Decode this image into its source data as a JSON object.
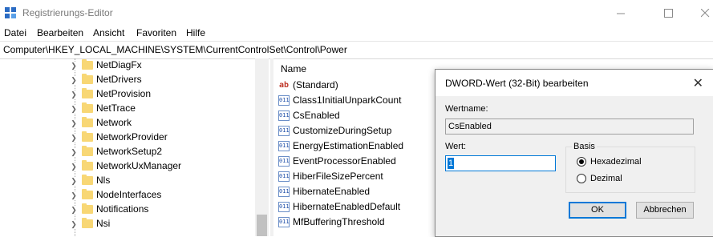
{
  "window": {
    "title": "Registrierungs-Editor",
    "minimize_icon": "minimize-icon",
    "maximize_icon": "maximize-icon",
    "close_icon": "close-icon"
  },
  "menu": [
    "Datei",
    "Bearbeiten",
    "Ansicht",
    "Favoriten",
    "Hilfe"
  ],
  "address": "Computer\\HKEY_LOCAL_MACHINE\\SYSTEM\\CurrentControlSet\\Control\\Power",
  "tree": {
    "items": [
      {
        "label": "NetDiagFx",
        "expandable": true
      },
      {
        "label": "NetDrivers",
        "expandable": true
      },
      {
        "label": "NetProvision",
        "expandable": true
      },
      {
        "label": "NetTrace",
        "expandable": true
      },
      {
        "label": "Network",
        "expandable": true
      },
      {
        "label": "NetworkProvider",
        "expandable": true
      },
      {
        "label": "NetworkSetup2",
        "expandable": true
      },
      {
        "label": "NetworkUxManager",
        "expandable": true
      },
      {
        "label": "Nls",
        "expandable": true
      },
      {
        "label": "NodeInterfaces",
        "expandable": true
      },
      {
        "label": "Notifications",
        "expandable": true
      },
      {
        "label": "Nsi",
        "expandable": true
      }
    ]
  },
  "list": {
    "header": "Name",
    "items": [
      {
        "label": "(Standard)",
        "type": "sz",
        "icon_text": "ab"
      },
      {
        "label": "Class1InitialUnparkCount",
        "type": "dword",
        "icon_text": "011"
      },
      {
        "label": "CsEnabled",
        "type": "dword",
        "icon_text": "011"
      },
      {
        "label": "CustomizeDuringSetup",
        "type": "dword",
        "icon_text": "011"
      },
      {
        "label": "EnergyEstimationEnabled",
        "type": "dword",
        "icon_text": "011"
      },
      {
        "label": "EventProcessorEnabled",
        "type": "dword",
        "icon_text": "011"
      },
      {
        "label": "HiberFileSizePercent",
        "type": "dword",
        "icon_text": "011"
      },
      {
        "label": "HibernateEnabled",
        "type": "dword",
        "icon_text": "011"
      },
      {
        "label": "HibernateEnabledDefault",
        "type": "dword",
        "icon_text": "011"
      },
      {
        "label": "MfBufferingThreshold",
        "type": "dword",
        "icon_text": "011"
      }
    ]
  },
  "dialog": {
    "title": "DWORD-Wert (32-Bit) bearbeiten",
    "name_label": "Wertname:",
    "name_value": "CsEnabled",
    "value_label": "Wert:",
    "value": "1",
    "base_label": "Basis",
    "radio_hex": "Hexadezimal",
    "radio_dec": "Dezimal",
    "selected_base": "hex",
    "ok": "OK",
    "cancel": "Abbrechen"
  }
}
